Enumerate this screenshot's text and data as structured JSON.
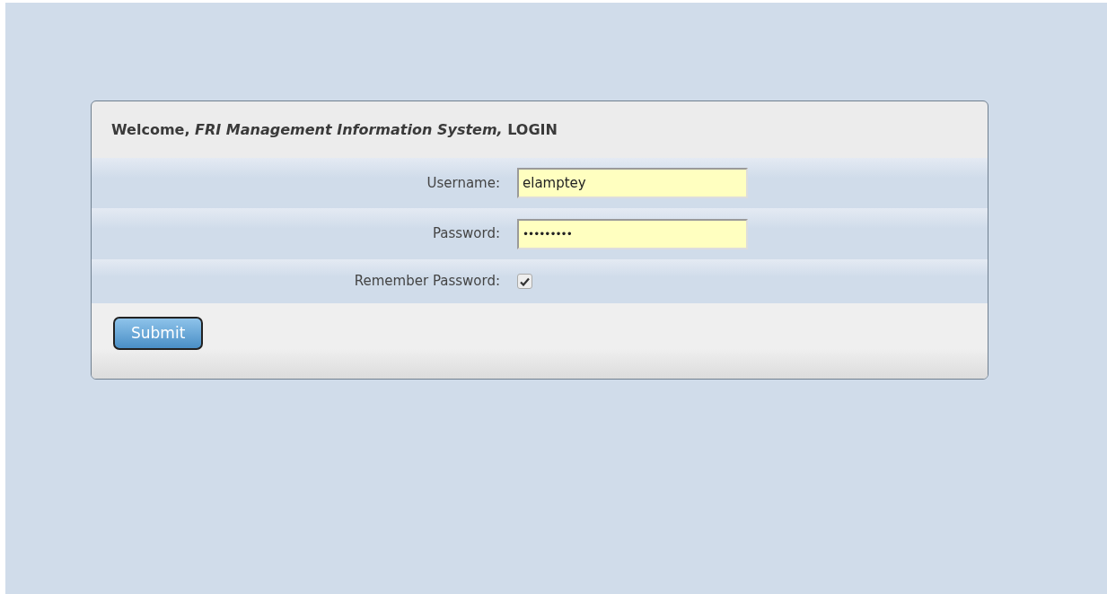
{
  "login_panel": {
    "title": "Welcome, *FRI Management Information System,* LOGIN",
    "fields": [
      {
        "kind": "text",
        "label": "Username:",
        "value": "elamptey"
      },
      {
        "kind": "password",
        "label": "Password:",
        "value": "•••••••••"
      },
      {
        "kind": "checkbox",
        "label": "Remember Password:",
        "checked": true
      }
    ],
    "submit_button": "Submit"
  }
}
